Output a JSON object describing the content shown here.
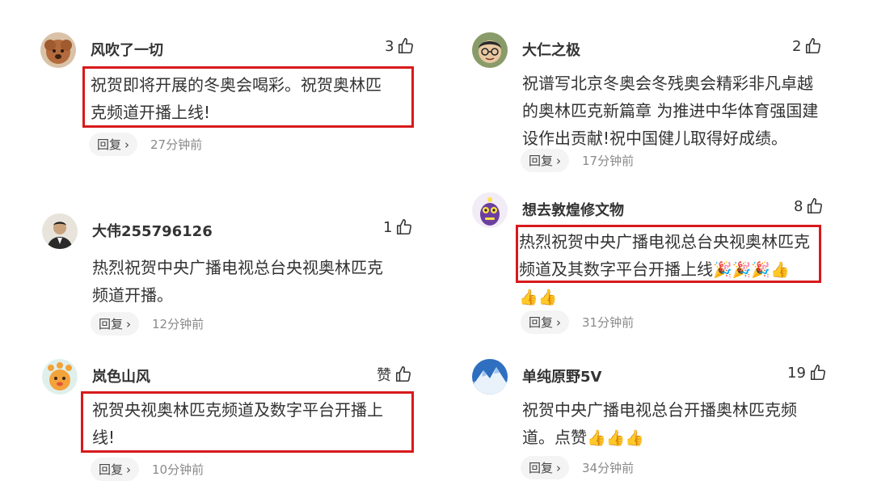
{
  "reply_label": "回复",
  "reply_chevron": "›",
  "comments": [
    {
      "user": "风吹了一切",
      "likes": "3",
      "lines": [
        "祝贺即将开展的冬奥会喝彩。祝贺奥林匹",
        "克频道开播上线!"
      ],
      "time": "27分钟前",
      "highlighted": true,
      "avatar_icon": "poodle-avatar"
    },
    {
      "user": "大伟255796126",
      "likes": "1",
      "lines": [
        "热烈祝贺中央广播电视总台央视奥林匹克",
        "频道开播。"
      ],
      "time": "12分钟前",
      "highlighted": false,
      "avatar_icon": "man-in-suit-avatar"
    },
    {
      "user": "岚色山风",
      "likes": "赞",
      "lines": [
        "祝贺央视奥林匹克频道及数字平台开播上",
        "线!"
      ],
      "time": "10分钟前",
      "highlighted": true,
      "avatar_icon": "cartoon-creature-avatar"
    },
    {
      "user": "大仁之极",
      "likes": "2",
      "lines": [
        "祝谱写北京冬奥会冬残奥会精彩非凡卓越",
        "的奥林匹克新篇章 为推进中华体育强国建",
        "设作出贡献!祝中国健儿取得好成绩。"
      ],
      "time": "17分钟前",
      "highlighted": false,
      "avatar_icon": "cartoon-man-glasses-avatar"
    },
    {
      "user": "想去敦煌修文物",
      "likes": "8",
      "lines": [
        "热烈祝贺中央广播电视总台央视奥林匹克",
        "频道及其数字平台开播上线"
      ],
      "emoji_after_line2": "🎉🎉🎉👍",
      "emoji_line3": "👍👍",
      "time": "31分钟前",
      "highlighted": true,
      "avatar_icon": "purple-monster-avatar"
    },
    {
      "user": "单纯原野5V",
      "likes": "19",
      "lines": [
        "祝贺中央广播电视总台开播奥林匹克频",
        "道。点赞"
      ],
      "emoji_after_line2": "👍👍👍",
      "time": "34分钟前",
      "highlighted": false,
      "avatar_icon": "snow-mountain-avatar"
    }
  ],
  "colors": {
    "highlight_border": "#d8191c",
    "text": "#333333",
    "time": "#8a8a8a",
    "reply_bg": "#f4f4f4"
  }
}
